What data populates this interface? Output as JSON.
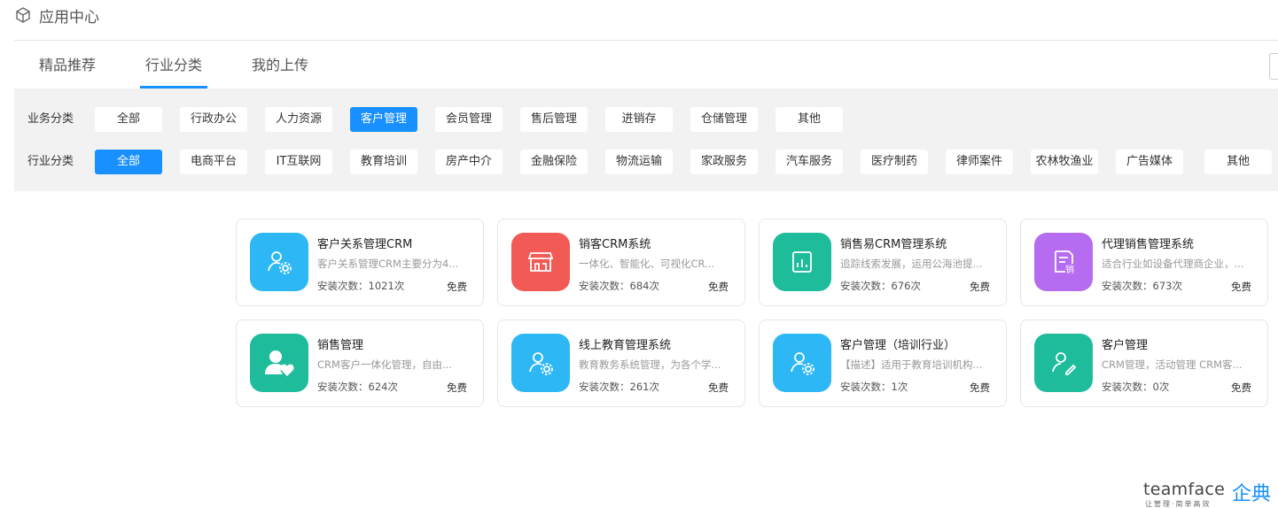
{
  "header": {
    "title": "应用中心"
  },
  "tabs": [
    {
      "label": "精品推荐",
      "active": false
    },
    {
      "label": "行业分类",
      "active": true
    },
    {
      "label": "我的上传",
      "active": false
    }
  ],
  "filters": {
    "business": {
      "label": "业务分类",
      "options": [
        "全部",
        "行政办公",
        "人力资源",
        "客户管理",
        "会员管理",
        "售后管理",
        "进销存",
        "仓储管理",
        "其他"
      ],
      "selected": "客户管理"
    },
    "industry": {
      "label": "行业分类",
      "options": [
        "全部",
        "电商平台",
        "IT互联网",
        "教育培训",
        "房产中介",
        "金融保险",
        "物流运输",
        "家政服务",
        "汽车服务",
        "医疗制药",
        "律师案件",
        "农林牧渔业",
        "广告媒体",
        "其他"
      ],
      "selected": "全部"
    }
  },
  "apps": [
    {
      "name": "客户关系管理CRM",
      "desc": "客户关系管理CRM主要分为4...",
      "installs": "安装次数：1021次",
      "price": "免费",
      "icon": "user-gear-icon",
      "color": "#2db7f5"
    },
    {
      "name": "销客CRM系统",
      "desc": "一体化、智能化、可视化CR...",
      "installs": "安装次数：684次",
      "price": "免费",
      "icon": "storefront-icon",
      "color": "#f25a55"
    },
    {
      "name": "销售易CRM管理系统",
      "desc": "追踪线索发展，运用公海池提...",
      "installs": "安装次数：676次",
      "price": "免费",
      "icon": "report-icon",
      "color": "#1fbc9c"
    },
    {
      "name": "代理销售管理系统",
      "desc": "适合行业如设备代理商企业，...",
      "installs": "安装次数：673次",
      "price": "免费",
      "icon": "sales-doc-icon",
      "color": "#b56cf0"
    },
    {
      "name": "销售管理",
      "desc": "CRM客户一体化管理，自由...",
      "installs": "安装次数：624次",
      "price": "免费",
      "icon": "user-heart-icon",
      "color": "#1fbc9c"
    },
    {
      "name": "线上教育管理系统",
      "desc": "教育教务系统管理，为各个学...",
      "installs": "安装次数：261次",
      "price": "免费",
      "icon": "user-gear-icon",
      "color": "#2db7f5"
    },
    {
      "name": "客户管理（培训行业）",
      "desc": "【描述】适用于教育培训机构...",
      "installs": "安装次数：1次",
      "price": "免费",
      "icon": "user-gear-icon",
      "color": "#2db7f5"
    },
    {
      "name": "客户管理",
      "desc": "CRM管理，活动管理 CRM客...",
      "installs": "安装次数：0次",
      "price": "免费",
      "icon": "user-edit-icon",
      "color": "#1fbc9c"
    }
  ],
  "brand": {
    "name": "teamface",
    "cn": "企典",
    "slogan": "让管理·简单高效"
  }
}
